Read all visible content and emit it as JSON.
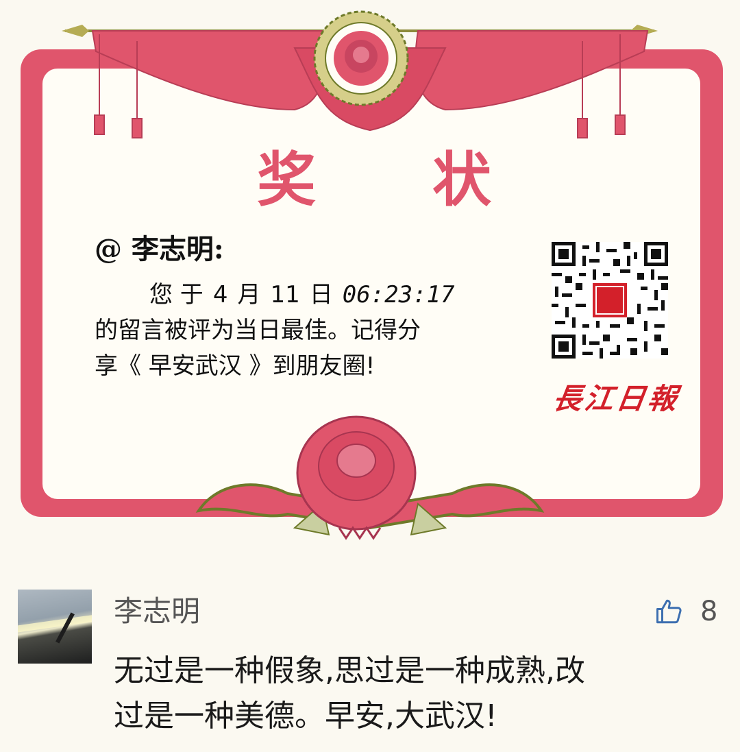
{
  "certificate": {
    "title": "奖 状",
    "recipient": "@ 李志明:",
    "message": {
      "prefix": "您 于",
      "month": "4",
      "month_unit": "月",
      "day": "11",
      "day_unit": "日",
      "time": "06:23:17",
      "line2": "的留言被评为当日最佳。记得分",
      "line3": "享《 早安武汉 》到朋友圈!"
    },
    "brand": "長江日報",
    "colors": {
      "frame": "#e0556c",
      "drape": "#e0556c",
      "title": "#e0556c",
      "brand": "#d3202a"
    }
  },
  "comment": {
    "username": "李志明",
    "like_count": "8",
    "lines": [
      "无过是一种假象,思过是一种成熟,改",
      "过是一种美德。早安,大武汉!"
    ]
  }
}
